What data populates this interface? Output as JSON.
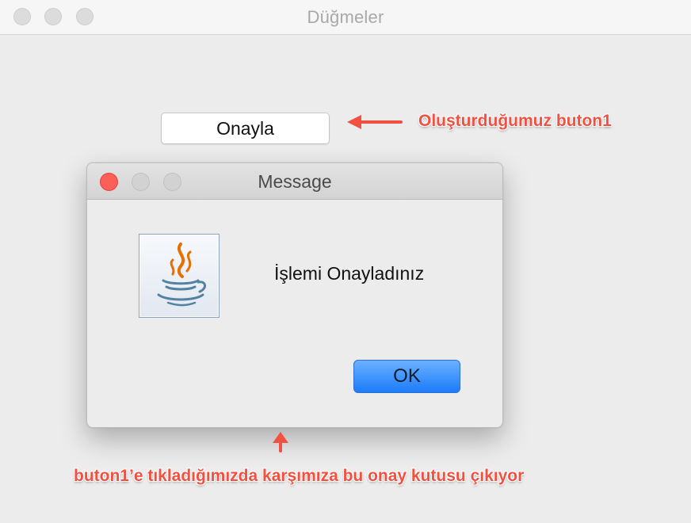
{
  "window": {
    "title": "Düğmeler"
  },
  "main": {
    "confirm_button_label": "Onayla"
  },
  "dialog": {
    "title": "Message",
    "message": "İşlemi Onayladınız",
    "icon": "java-icon",
    "ok_label": "OK"
  },
  "annotations": {
    "button_note": "Oluşturduğumuz buton1",
    "dialog_note": "buton1’e tıkladığımızda karşımıza bu onay kutusu çıkıyor"
  },
  "colors": {
    "annotation": "#f25040",
    "ok_button": "#1c7cf9",
    "close_button": "#fc5f57"
  }
}
